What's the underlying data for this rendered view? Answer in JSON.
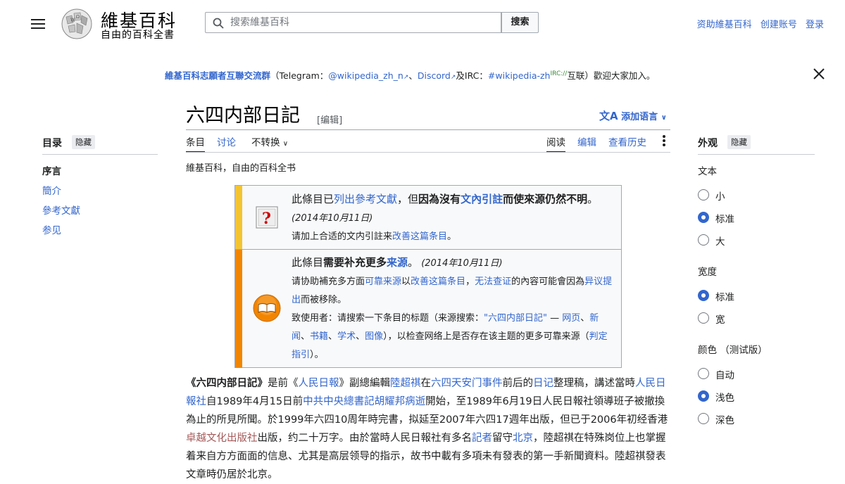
{
  "header": {
    "menu_icon": "hamburger-icon",
    "wordmark": "維基百科",
    "tagline": "自由的百科全書",
    "search_placeholder": "搜索維基百科",
    "search_button": "搜索",
    "user_links": [
      "资助維基百科",
      "创建账号",
      "登录"
    ]
  },
  "sitenotice": {
    "group": "維基百科志願者互聯交流群",
    "open": "（Telegram：",
    "telegram": "@wikipedia_zh_n",
    "sep1": "、",
    "discord": "Discord",
    "and": "及IRC：",
    "irc": "#wikipedia-zh",
    "irc_sup": "IRC://",
    "tail": "互联）歡迎大家加入。"
  },
  "page": {
    "title": "六四内部日記",
    "edit": "[编辑]",
    "add_languages": "添加语言",
    "site_sub": "維基百科，自由的百科全书"
  },
  "tabs": {
    "article": "条目",
    "talk": "讨论",
    "variant": "不转换",
    "read": "阅读",
    "edit": "编辑",
    "history": "查看历史"
  },
  "toc": {
    "title": "目录",
    "hide": "隐藏",
    "items": [
      "序言",
      "簡介",
      "參考文獻",
      "参见"
    ]
  },
  "appearance": {
    "title": "外观",
    "hide": "隐藏",
    "text_label": "文本",
    "text_options": [
      "小",
      "标准",
      "大"
    ],
    "text_selected": "标准",
    "width_label": "宽度",
    "width_options": [
      "标准",
      "宽"
    ],
    "width_selected": "标准",
    "color_label": "颜色 （测试版）",
    "color_options": [
      "自动",
      "浅色",
      "深色"
    ],
    "color_selected": "浅色"
  },
  "ambox1": {
    "p1": "此條目已",
    "l1": "列出參考文獻",
    "p2": "，但",
    "b1": "因為沒有",
    "l2": "文內引註",
    "b2": "而使來源仍然不明",
    "p3": "。",
    "date": "(2014年10月11日)",
    "s1": "请加上合适的文内引註来",
    "s2": "改善这篇条目",
    "s3": "。",
    "icon": "question-book-icon"
  },
  "ambox2": {
    "p1": "此條目",
    "b1": "需要补充更多",
    "l1": "来源",
    "p2": "。",
    "date": "(2014年10月11日)",
    "s1": "请协助補充多方面",
    "l2": "可靠来源",
    "s2": "以",
    "l3": "改善这篇条目",
    "s3": "，",
    "l4": "无法查证",
    "s4": "的內容可能會因為",
    "l5": "异议提出",
    "s5": "而被移除。",
    "n1": "致使用者：请搜索一下条目的标题（来源搜索：",
    "n2": "\"六四内部日記\"",
    "n3": " — ",
    "n4": "网页",
    "n5": "、",
    "n6": "新闻",
    "n7": "、",
    "n8": "书籍",
    "n9": "、",
    "n10": "学术",
    "n11": "、",
    "n12": "图像",
    "n13": "），以检查网络上是否存在该主题的更多可靠来源（",
    "n14": "判定指引",
    "n15": "）。",
    "icon": "books-icon"
  },
  "body": {
    "t1": "《六四内部日記》",
    "t2": "是前《",
    "l1": "人民日報",
    "t3": "》副總編輯",
    "l2": "陸超祺",
    "t4": "在",
    "l3": "六四天安门事件",
    "t5": "前后的",
    "l4": "日记",
    "t6": "整理稿，講述當時",
    "l5": "人民日報社",
    "t7": "自1989年4月15日前",
    "l6": "中共中央總書記",
    "l7": "胡耀邦病逝",
    "t8": "開始，至1989年6月19日人民日報社領導班子被撤換為止的所見所聞。於1999年六四10周年時完書，拟延至2007年六四17週年出版，但已于2006年初经香港",
    "l8": "卓越文化出版社",
    "t9": "出版，约二十万字。由於當時人民日報社有多名",
    "l9": "記者",
    "t10": "留守",
    "l10": "北京",
    "t11": "，陸超祺在特殊岗位上也掌握着来自方方面面的信息、尤其是高层领导的指示，故书中載有多項未有發表的第一手新聞資料。陸超祺發表文章時仍居於北京。"
  }
}
